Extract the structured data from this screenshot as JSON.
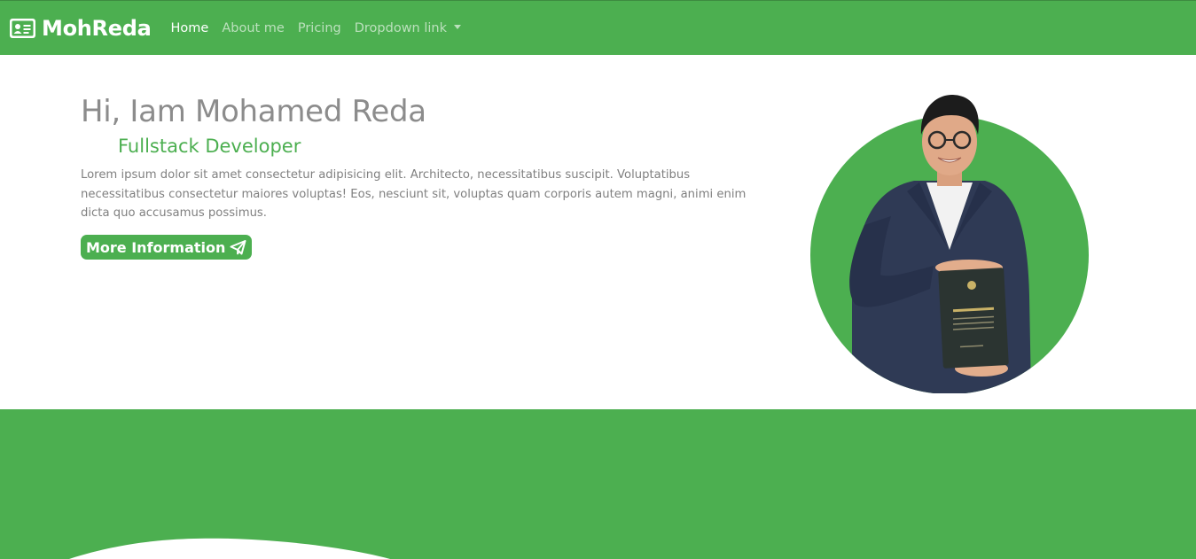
{
  "navbar": {
    "brand": "MohReda",
    "brand_icon": "id-card-icon",
    "links": [
      "Home",
      "About me",
      "Pricing",
      "Dropdown link"
    ],
    "active_link": "Home"
  },
  "hero": {
    "title": "Hi, Iam Mohamed Reda",
    "subtitle": "Fullstack Developer",
    "description": "Lorem ipsum dolor sit amet consectetur adipisicing elit. Architecto, necessitatibus suscipit. Voluptatibus necessitatibus consectetur maiores voluptas! Eos, nesciunt sit, voluptas quam corporis autem magni, animi enim dicta quo accusamus possimus.",
    "button_label": "More Information",
    "button_icon": "paper-plane-icon"
  },
  "colors": {
    "primary": "#4caf50",
    "title_gray": "#8c8c8c",
    "text_gray": "#808080"
  }
}
